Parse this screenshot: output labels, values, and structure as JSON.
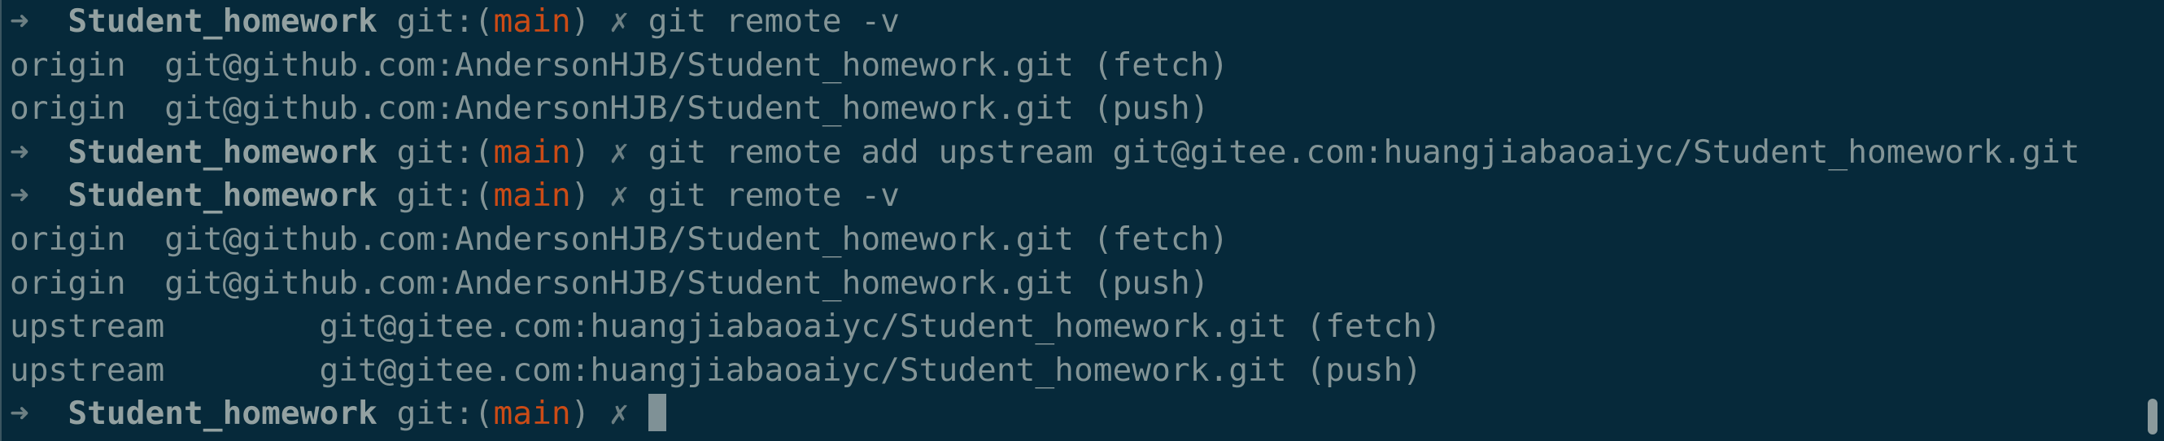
{
  "prompt": {
    "arrow": "➜",
    "dir": "Student_homework",
    "git_prefix": "git:(",
    "branch": "main",
    "git_suffix": ")",
    "dirty": "✗"
  },
  "lines": [
    {
      "type": "prompt",
      "command": "git remote -v"
    },
    {
      "type": "output",
      "text": "origin  git@github.com:AndersonHJB/Student_homework.git (fetch)"
    },
    {
      "type": "output",
      "text": "origin  git@github.com:AndersonHJB/Student_homework.git (push)"
    },
    {
      "type": "prompt",
      "command": "git remote add upstream git@gitee.com:huangjiabaoaiyc/Student_homework.git"
    },
    {
      "type": "prompt",
      "command": "git remote -v"
    },
    {
      "type": "output",
      "text": "origin  git@github.com:AndersonHJB/Student_homework.git (fetch)"
    },
    {
      "type": "output",
      "text": "origin  git@github.com:AndersonHJB/Student_homework.git (push)"
    },
    {
      "type": "output",
      "text": "upstream        git@gitee.com:huangjiabaoaiyc/Student_homework.git (fetch)"
    },
    {
      "type": "output",
      "text": "upstream        git@gitee.com:huangjiabaoaiyc/Student_homework.git (push)"
    },
    {
      "type": "prompt",
      "command": ""
    }
  ],
  "colors": {
    "background": "#06293a",
    "text": "#839496",
    "branch": "#cb4b16"
  }
}
